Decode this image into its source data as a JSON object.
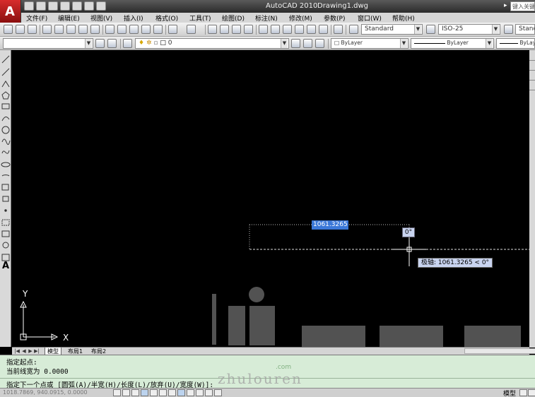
{
  "title_bar": {
    "app_name": "AutoCAD 2010",
    "doc_name": "Drawing1.dwg",
    "search_placeholder": "键入关键字"
  },
  "menu_bar": [
    "文件(F)",
    "编辑(E)",
    "视图(V)",
    "插入(I)",
    "格式(O)",
    "工具(T)",
    "绘图(D)",
    "标注(N)",
    "修改(M)",
    "参数(P)",
    "窗口(W)",
    "帮助(H)"
  ],
  "styles_toolbar": {
    "text_style": "Standard",
    "dim_style": "ISO-25",
    "table_style": "Standard"
  },
  "layers_toolbar": {
    "layer_name": "0",
    "color": "ByLayer",
    "linetype": "ByLayer",
    "lineweight": "ByLayer"
  },
  "dynamic_input": {
    "length_value": "1061.3265",
    "angle_value": "0°",
    "polar_tooltip": "极轴: 1061.3265 < 0°"
  },
  "ucs": {
    "x_label": "X",
    "y_label": "Y"
  },
  "layout_tabs": [
    "模型",
    "布局1",
    "布局2"
  ],
  "command_history": [
    "指定起点:",
    "当前线宽为 0.0000"
  ],
  "command_prompt": "指定下一个点或 [圆弧(A)/半宽(H)/长度(L)/放弃(U)/宽度(W)]:",
  "status": {
    "coordinates": "1018.7869, 940.0915, 0.0000",
    "model_label": "模型"
  },
  "watermark": {
    "word": "zhulouren",
    "suffix": ".com"
  },
  "colors": {
    "canvas_background": "#000000",
    "command_background": "#d7ecd7",
    "highlight_input": "#3b78d8",
    "tooltip_background": "#c9d4f0",
    "app_logo": "#c62828"
  }
}
